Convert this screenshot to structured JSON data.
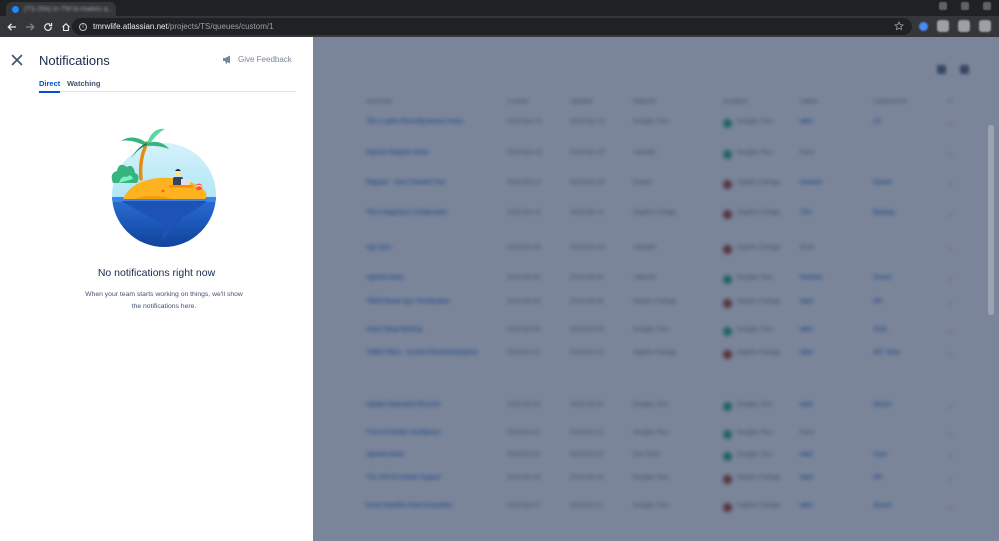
{
  "browser": {
    "tab_title": "[TS-284] In-TM to-makes a...",
    "url_host": "tmrwlife.atlassian.net",
    "url_path": "/projects/TS/queues/custom/1"
  },
  "panel": {
    "title": "Notifications",
    "feedback_label": "Give Feedback",
    "tabs": [
      {
        "label": "Direct",
        "active": true
      },
      {
        "label": "Watching",
        "active": false
      }
    ],
    "empty_title": "No notifications right now",
    "empty_description": "When your team starts working on things, we'll show the notifications here."
  },
  "colors": {
    "accent": "#0052CC",
    "overlay": "rgba(9,30,66,0.54)",
    "priority": "#DE350B"
  },
  "background_queue": {
    "headers": [
      "Summary",
      "Created",
      "Updated",
      "Reporter",
      "Assignee",
      "Labels",
      "Components",
      "P"
    ],
    "rows": [
      [
        "TM-1 Labels Reconfig feature rooms",
        "2019-Nov-13",
        "2019-Nov-13",
        "Douglas Tess",
        "Douglas Tess",
        "label",
        "UX"
      ],
      [
        "Improve Register Deals",
        "2019-Nov-15",
        "2019-Nov-15",
        "calendar",
        "Douglas Tess",
        "None",
        ""
      ],
      [
        "Register - View Checklist Text",
        "2019-Nov-11",
        "2019-Nov-15",
        "Keeper",
        "Sujatho Cartago",
        "frontend",
        "Search"
      ],
      [
        "TM-4 Integration Configuration",
        "2019-Nov-11",
        "2019-Nov-11",
        "Sujatho Cartago",
        "Sujatho Cartago",
        "TSU",
        "Backlog"
      ],
      [
        "App Sync",
        "2019-Oct-28",
        "2019-Nov-15",
        "calendar",
        "Sujatho Cartago",
        "None",
        ""
      ],
      [
        "Agenda Notes",
        "2019-Oct-24",
        "2019-Oct-24",
        "calendar",
        "Douglas Tess",
        "frontend",
        "Search"
      ],
      [
        "TMM3 Board Ops: Prioritization",
        "2019-Oct-18",
        "2019-Oct-28",
        "Sujatho Cartago",
        "Sujatho Cartago",
        "label",
        "API"
      ],
      [
        "Clean Setup Backlog",
        "2019-Oct-09",
        "2019-Oct-09",
        "Douglas Tess",
        "Douglas Tess",
        "label",
        "Tools"
      ],
      [
        "TMM3 Filters - Current Recommendations",
        "2019-Oct-13",
        "2019-Oct-13",
        "Sujatho Cartago",
        "Sujatho Cartago",
        "label",
        "API, Tools"
      ],
      [
        "Update Dependent Records",
        "2019-Oct-03",
        "2019-Oct-03",
        "Douglas Tess",
        "Douglas Tess",
        "label",
        "Search"
      ],
      [
        "Front of Dunder Confidence",
        "2019-Oct-21",
        "2019-Oct-21",
        "Douglas Tess",
        "Douglas Tess",
        "None",
        ""
      ],
      [
        "Agenda Notes",
        "2019-Oct-22",
        "2019-Oct-22",
        "Dev Team",
        "Douglas Tess",
        "label",
        "Tools"
      ],
      [
        "TSL-200 On Initiate Support",
        "2019-Oct-16",
        "2019-Oct-16",
        "Douglas Tess",
        "Sujatho Cartago",
        "label",
        "API"
      ],
      [
        "Event Heat/Re-Clean Evaluation",
        "2019-Oct-17",
        "2019-Oct-17",
        "Douglas Tess",
        "Sujatho Cartago",
        "label",
        "Search"
      ]
    ]
  }
}
